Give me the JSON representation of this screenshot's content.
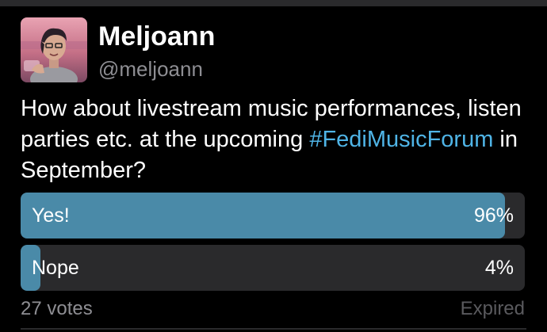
{
  "author": {
    "display_name": "Meljoann",
    "handle": "@meljoann"
  },
  "status": {
    "text_before": "How about livestream music performances, listen parties etc. at the upcoming ",
    "hashtag": "#FediMusicForum",
    "text_after": " in September?"
  },
  "poll": {
    "options": [
      {
        "label": "Yes!",
        "percent_text": "96%",
        "fraction": 0.96
      },
      {
        "label": "Nope",
        "percent_text": "4%",
        "fraction": 0.04
      }
    ],
    "votes_text": "27 votes",
    "status_text": "Expired"
  },
  "colors": {
    "background": "#000000",
    "bar_track": "#2a2a2c",
    "bar_fill": "#4a8aa8",
    "hashtag": "#4fb4e6",
    "muted": "#8e8e93"
  }
}
